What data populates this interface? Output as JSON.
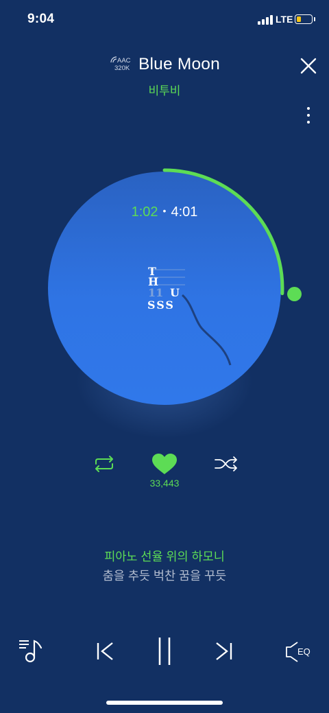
{
  "status_bar": {
    "time": "9:04",
    "network": "LTE",
    "battery_level": 0.3,
    "battery_color": "#f5c518"
  },
  "header": {
    "quality_codec": "AAC",
    "quality_bitrate": "320K",
    "title": "Blue Moon",
    "artist": "비투비",
    "close_icon": "close-icon",
    "more_icon": "more-vertical-icon"
  },
  "player": {
    "elapsed": "1:02",
    "duration": "4:01",
    "progress": 0.257,
    "album_art_text": [
      "T",
      "H",
      "11",
      "U",
      "SSS"
    ]
  },
  "actions": {
    "repeat_icon": "repeat-icon",
    "like_icon": "heart-icon",
    "like_count": "33,443",
    "shuffle_icon": "shuffle-icon"
  },
  "lyrics": {
    "current": "피아노 선율 위의 하모니",
    "next": "춤을 추듯 벅찬 꿈을 꾸듯"
  },
  "controls": {
    "playlist_icon": "playlist-icon",
    "prev_icon": "skip-previous-icon",
    "pause_icon": "pause-icon",
    "next_icon": "skip-next-icon",
    "eq_label": "EQ"
  },
  "colors": {
    "accent": "#5ddc55",
    "background": "#123063",
    "disc": "#2f74e4"
  }
}
